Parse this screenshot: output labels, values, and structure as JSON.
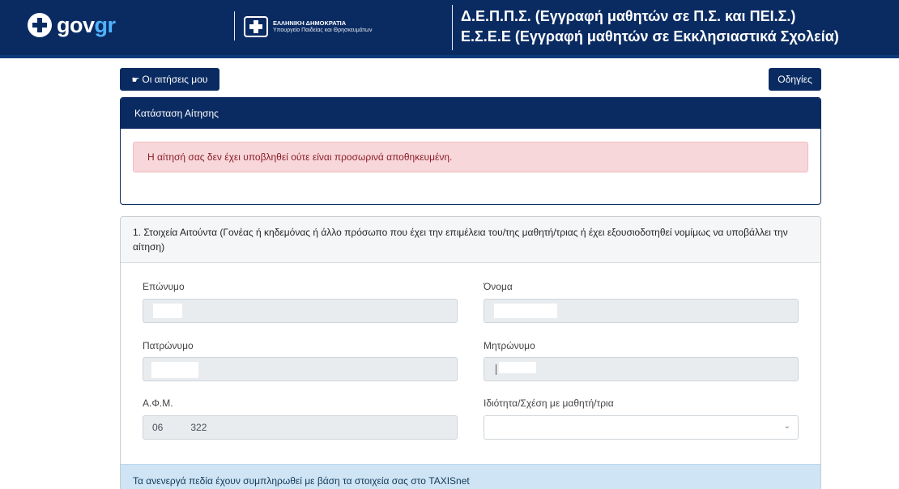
{
  "header": {
    "brand_main": "gov",
    "brand_accent": "gr",
    "ministry_line1": "ΕΛΛΗΝΙΚΗ ΔΗΜΟΚΡΑΤΙΑ",
    "ministry_line2": "Υπουργείο Παιδείας και Θρησκευμάτων",
    "title_line1": "Δ.Ε.Π.Π.Σ. (Εγγραφή μαθητών σε Π.Σ. και ΠΕΙ.Σ.)",
    "title_line2": "Ε.Σ.Ε.Ε (Εγγραφή μαθητών σε Εκκλησιαστικά Σχολεία)"
  },
  "toolbar": {
    "my_applications_label": "Οι αιτήσεις μου",
    "my_applications_icon": "hand-pointing-icon",
    "help_label": "Οδηγίες"
  },
  "status_card": {
    "title": "Κατάσταση Αίτησης",
    "alert_text": "Η αίτησή σας δεν έχει υποβληθεί ούτε είναι προσωρινά αποθηκευμένη."
  },
  "applicant_card": {
    "title": "1. Στοιχεία Αιτούντα (Γονέας ή κηδεμόνας ή άλλο πρόσωπο που έχει την επιμέλεια του/της μαθητή/τριας ή έχει εξουσιοδοτηθεί νομίμως να υποβάλλει την αίτηση)",
    "fields": {
      "surname": {
        "label": "Επώνυμο",
        "value": ""
      },
      "first_name": {
        "label": "Όνομα",
        "value": ""
      },
      "father_name": {
        "label": "Πατρώνυμο",
        "value": ""
      },
      "mother_name": {
        "label": "Μητρώνυμο",
        "value": ""
      },
      "afm": {
        "label": "Α.Φ.Μ.",
        "value_prefix": "06",
        "value_suffix": "322"
      },
      "relation": {
        "label": "Ιδιότητα/Σχέση με μαθητή/τρια",
        "selected": ""
      }
    },
    "info_text": "Τα ανενεργά πεδία έχουν συμπληρωθεί με βάση τα στοιχεία σας στο TAXISnet"
  },
  "colors": {
    "primary": "#0a2b62",
    "accent_gr": "#4fb4ff",
    "alert_bg": "#f8d7da",
    "info_bg": "#cfe4f4"
  }
}
